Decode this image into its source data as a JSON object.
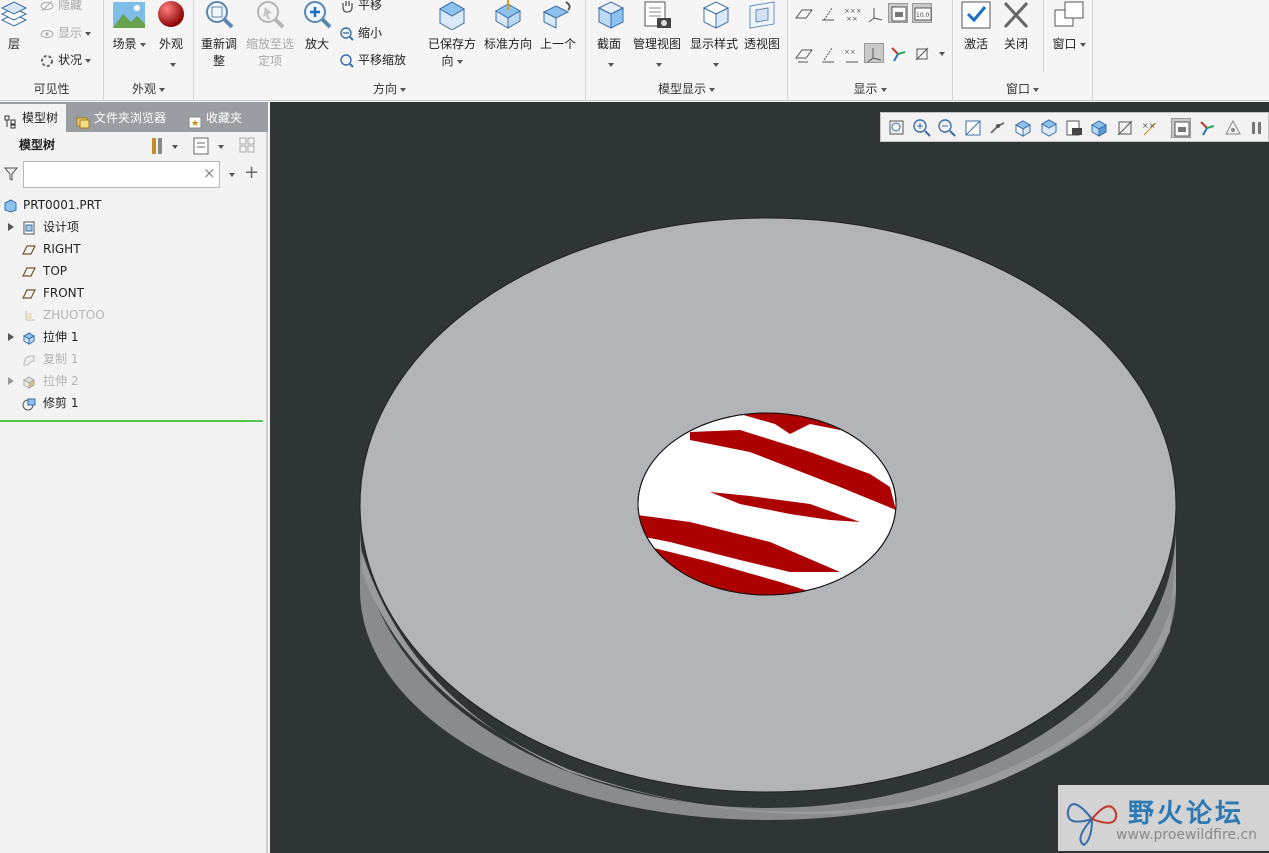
{
  "ribbon": {
    "visibility": {
      "label": "可见性",
      "layer_label": "层",
      "hide_label": "隐藏",
      "show_label": "显示",
      "status_label": "状况"
    },
    "appearance": {
      "label": "外观",
      "scene_label": "场景",
      "appearance_label": "外观"
    },
    "orientation": {
      "label": "方向",
      "refit_label_1": "重新调",
      "refit_label_2": "整",
      "zoom_selected_label_1": "缩放至选",
      "zoom_selected_label_2": "定项",
      "zoom_in_label": "放大",
      "pan_label": "平移",
      "zoom_out_label": "缩小",
      "pan_zoom_label": "平移缩放",
      "saved_orientations_label_1": "已保存方",
      "saved_orientations_label_2": "向",
      "standard_orientation_label": "标准方向",
      "previous_label": "上一个"
    },
    "model_display": {
      "label": "模型显示",
      "section_label": "截面",
      "manage_views_label": "管理视图",
      "display_style_label": "显示样式",
      "perspective_label": "透视图"
    },
    "show": {
      "label": "显示"
    },
    "window": {
      "label": "窗口",
      "activate_label": "激活",
      "close_label": "关闭",
      "window_label": "窗口"
    }
  },
  "left_panel": {
    "tabs": [
      {
        "label": "模型树"
      },
      {
        "label": "文件夹浏览器"
      },
      {
        "label": "收藏夹"
      }
    ],
    "tree_header": "模型树",
    "search": {
      "value": "",
      "clear": "×"
    },
    "add_label": "+",
    "tree_items": [
      {
        "label": "PRT0001.PRT"
      },
      {
        "label": "设计项"
      },
      {
        "label": "RIGHT"
      },
      {
        "label": "TOP"
      },
      {
        "label": "FRONT"
      },
      {
        "label": "ZHUOTOO"
      },
      {
        "label": "拉伸 1"
      },
      {
        "label": "复制 1"
      },
      {
        "label": "拉伸 2"
      },
      {
        "label": "修剪 1"
      }
    ]
  },
  "viewport": {
    "background": "#2f3435",
    "model_face_color": "#b3b4b7",
    "model_side_color": "#8a8b8d",
    "hole_fill_color": "#ffffff",
    "artifact_color": "#ad0000"
  },
  "watermark": {
    "title": "野火论坛",
    "url": "www.proewildfire.cn"
  }
}
